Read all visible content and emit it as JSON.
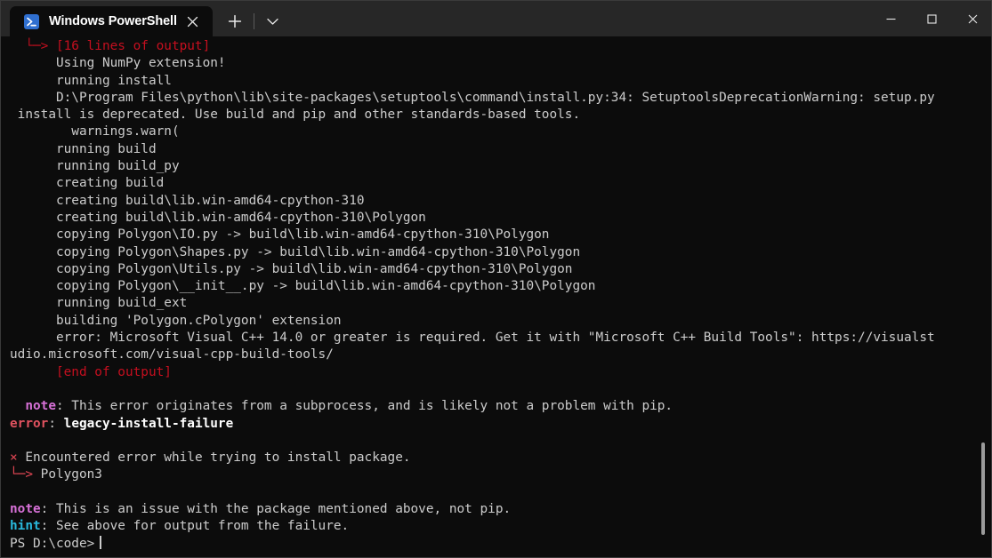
{
  "window": {
    "controls": {
      "minimize": "–",
      "maximize": "□",
      "close": "✕"
    }
  },
  "tabbar": {
    "tab_title": "Windows PowerShell",
    "close_label": "✕",
    "new_tab_label": "+",
    "dropdown_label": "⌄",
    "icon": "powershell-icon"
  },
  "colors": {
    "titlebar_bg": "#272727",
    "terminal_bg": "#0c0c0c",
    "foreground": "#cccccc",
    "red": "#c50f1f",
    "bright_red": "#e74856",
    "magenta": "#d670d6",
    "cyan": "#29b8db",
    "error_label": "#e0525f"
  },
  "terminal": {
    "prompt": "PS D:\\code>",
    "lines": [
      {
        "id": "l01",
        "segments": [
          {
            "text": "  ",
            "cls": "c-white"
          },
          {
            "text": "└─> ",
            "cls": "c-red"
          },
          {
            "text": "[16 lines of output]",
            "cls": "c-red"
          }
        ]
      },
      {
        "id": "l02",
        "segments": [
          {
            "text": "      Using NumPy extension!",
            "cls": "c-white"
          }
        ]
      },
      {
        "id": "l03",
        "segments": [
          {
            "text": "      running install",
            "cls": "c-white"
          }
        ]
      },
      {
        "id": "l04",
        "segments": [
          {
            "text": "      D:\\Program Files\\python\\lib\\site-packages\\setuptools\\command\\install.py:34: SetuptoolsDeprecationWarning: setup.py",
            "cls": "c-white"
          }
        ]
      },
      {
        "id": "l05",
        "segments": [
          {
            "text": " install is deprecated. Use build and pip and other standards-based tools.",
            "cls": "c-white"
          }
        ]
      },
      {
        "id": "l06",
        "segments": [
          {
            "text": "        warnings.warn(",
            "cls": "c-white"
          }
        ]
      },
      {
        "id": "l07",
        "segments": [
          {
            "text": "      running build",
            "cls": "c-white"
          }
        ]
      },
      {
        "id": "l08",
        "segments": [
          {
            "text": "      running build_py",
            "cls": "c-white"
          }
        ]
      },
      {
        "id": "l09",
        "segments": [
          {
            "text": "      creating build",
            "cls": "c-white"
          }
        ]
      },
      {
        "id": "l10",
        "segments": [
          {
            "text": "      creating build\\lib.win-amd64-cpython-310",
            "cls": "c-white"
          }
        ]
      },
      {
        "id": "l11",
        "segments": [
          {
            "text": "      creating build\\lib.win-amd64-cpython-310\\Polygon",
            "cls": "c-white"
          }
        ]
      },
      {
        "id": "l12",
        "segments": [
          {
            "text": "      copying Polygon\\IO.py -> build\\lib.win-amd64-cpython-310\\Polygon",
            "cls": "c-white"
          }
        ]
      },
      {
        "id": "l13",
        "segments": [
          {
            "text": "      copying Polygon\\Shapes.py -> build\\lib.win-amd64-cpython-310\\Polygon",
            "cls": "c-white"
          }
        ]
      },
      {
        "id": "l14",
        "segments": [
          {
            "text": "      copying Polygon\\Utils.py -> build\\lib.win-amd64-cpython-310\\Polygon",
            "cls": "c-white"
          }
        ]
      },
      {
        "id": "l15",
        "segments": [
          {
            "text": "      copying Polygon\\__init__.py -> build\\lib.win-amd64-cpython-310\\Polygon",
            "cls": "c-white"
          }
        ]
      },
      {
        "id": "l16",
        "segments": [
          {
            "text": "      running build_ext",
            "cls": "c-white"
          }
        ]
      },
      {
        "id": "l17",
        "segments": [
          {
            "text": "      building 'Polygon.cPolygon' extension",
            "cls": "c-white"
          }
        ]
      },
      {
        "id": "l18",
        "segments": [
          {
            "text": "      error: Microsoft Visual C++ 14.0 or greater is required. Get it with \"Microsoft C++ Build Tools\": https://visualst",
            "cls": "c-white"
          }
        ]
      },
      {
        "id": "l19",
        "segments": [
          {
            "text": "udio.microsoft.com/visual-cpp-build-tools/",
            "cls": "c-white"
          }
        ]
      },
      {
        "id": "l20",
        "segments": [
          {
            "text": "      [end of output]",
            "cls": "c-red"
          }
        ]
      },
      {
        "id": "l21",
        "segments": [
          {
            "text": "",
            "cls": "c-white"
          }
        ]
      },
      {
        "id": "l22",
        "segments": [
          {
            "text": "  ",
            "cls": "c-white"
          },
          {
            "text": "note",
            "cls": "c-magenta"
          },
          {
            "text": ": This error originates from a subprocess, and is likely not a problem with pip.",
            "cls": "c-white"
          }
        ]
      },
      {
        "id": "l23",
        "segments": [
          {
            "text": "error",
            "cls": "c-errlbl"
          },
          {
            "text": ": ",
            "cls": "c-white"
          },
          {
            "text": "legacy-install-failure",
            "cls": "c-bwhite"
          }
        ]
      },
      {
        "id": "l24",
        "segments": [
          {
            "text": "",
            "cls": "c-white"
          }
        ]
      },
      {
        "id": "l25",
        "segments": [
          {
            "text": "×",
            "cls": "c-brred"
          },
          {
            "text": " Encountered error while trying to install package.",
            "cls": "c-white"
          }
        ]
      },
      {
        "id": "l26",
        "segments": [
          {
            "text": "└─> ",
            "cls": "c-brred"
          },
          {
            "text": "Polygon3",
            "cls": "c-white"
          }
        ]
      },
      {
        "id": "l27",
        "segments": [
          {
            "text": "",
            "cls": "c-white"
          }
        ]
      },
      {
        "id": "l28",
        "segments": [
          {
            "text": "note",
            "cls": "c-magenta"
          },
          {
            "text": ": This is an issue with the package mentioned above, not pip.",
            "cls": "c-white"
          }
        ]
      },
      {
        "id": "l29",
        "segments": [
          {
            "text": "hint",
            "cls": "c-cyan"
          },
          {
            "text": ": See above for output from the failure.",
            "cls": "c-white"
          }
        ]
      }
    ]
  }
}
